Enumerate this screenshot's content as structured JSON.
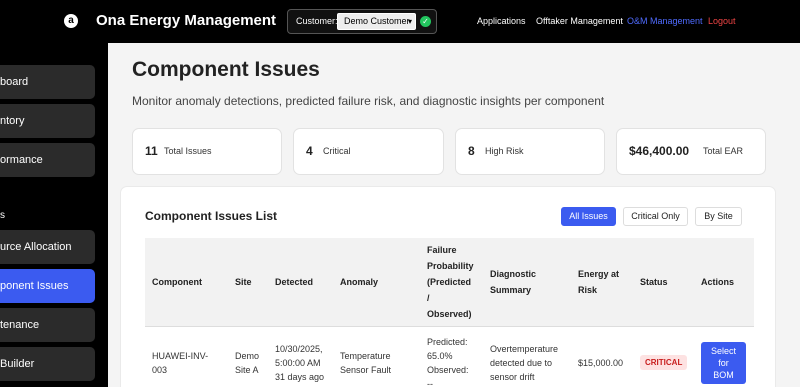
{
  "header": {
    "logo_glyph": "a",
    "app_title": "Ona Energy Management",
    "customer_label": "Customer:",
    "customer_selected": "Demo Customer",
    "nav": {
      "applications": "Applications",
      "offtaker": "Offtaker Management",
      "om": "O&M Management",
      "logout": "Logout"
    }
  },
  "sidebar": {
    "items": [
      {
        "label": "board"
      },
      {
        "label": "ntory"
      },
      {
        "label": "ormance"
      }
    ],
    "section_label": "s",
    "items2": [
      {
        "label": "urce Allocation"
      },
      {
        "label": "ponent Issues"
      },
      {
        "label": "tenance"
      },
      {
        "label": "Builder"
      }
    ]
  },
  "page": {
    "title": "Component Issues",
    "subtitle": "Monitor anomaly detections, predicted failure risk, and diagnostic insights per component"
  },
  "stats": [
    {
      "value": "11",
      "label": "Total Issues"
    },
    {
      "value": "4",
      "label": "Critical"
    },
    {
      "value": "8",
      "label": "High Risk"
    },
    {
      "value": "$46,400.00",
      "label": "Total EAR"
    }
  ],
  "issues_list": {
    "title": "Component Issues List",
    "filters": [
      "All Issues",
      "Critical Only",
      "By Site"
    ],
    "headers": {
      "component": "Component",
      "site": "Site",
      "detected": "Detected",
      "anomaly": "Anomaly",
      "failure_prob": [
        "Failure",
        "Probability",
        "(Predicted",
        "/",
        "Observed)"
      ],
      "diagnostic": [
        "Diagnostic",
        "Summary"
      ],
      "energy": [
        "Energy at",
        "Risk"
      ],
      "status": "Status",
      "actions": "Actions"
    },
    "rows": [
      {
        "component": [
          "HUAWEI-INV-",
          "003"
        ],
        "site": [
          "Demo",
          "Site A"
        ],
        "detected": [
          "10/30/2025,",
          "5:00:00 AM",
          "31 days ago"
        ],
        "anomaly": [
          "Temperature",
          "Sensor Fault"
        ],
        "failure_prob": [
          "Predicted:",
          "65.0%",
          "Observed:",
          "--"
        ],
        "diagnostic": [
          "Overtemperature",
          "detected due to",
          "sensor drift"
        ],
        "energy": "$15,000.00",
        "status": "CRITICAL",
        "action": [
          "Select",
          "for",
          "BOM"
        ]
      }
    ]
  }
}
